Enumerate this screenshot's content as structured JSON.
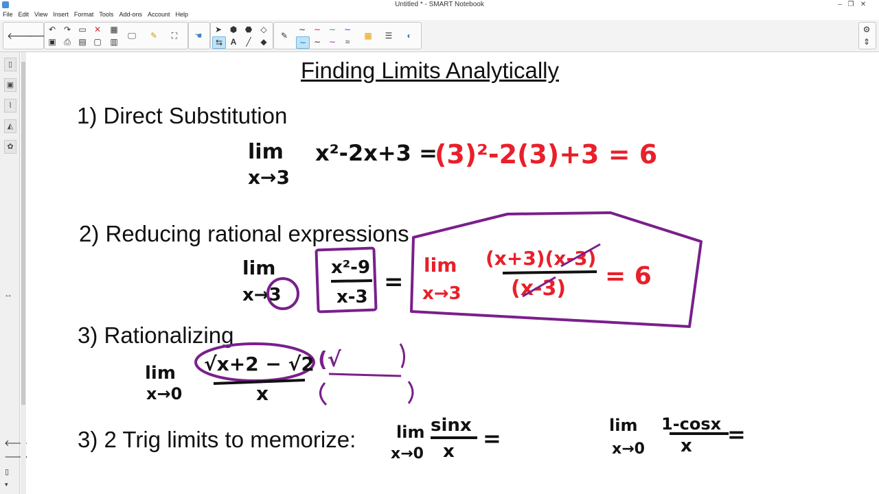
{
  "window": {
    "title": "Untitled * - SMART Notebook"
  },
  "menu": [
    "File",
    "Edit",
    "View",
    "Insert",
    "Format",
    "Tools",
    "Add-ons",
    "Account",
    "Help"
  ],
  "toolbar": {
    "icons": [
      "back-arrow-icon",
      "forward-arrow-icon",
      "undo-icon",
      "redo-icon",
      "paste-icon",
      "delete-icon",
      "table-icon",
      "screen-shade-icon",
      "capture-icon",
      "document-camera-icon",
      "select-icon",
      "shapes-icon",
      "fill-icon",
      "eraser-icon",
      "pen-icon",
      "line-icon",
      "text-icon",
      "magic-pen-icon",
      "grid-icon",
      "properties-icon",
      "settings-icon"
    ]
  },
  "page": {
    "title": "Finding Limits Analytically",
    "section1": "1) Direct Substitution",
    "section2": "2) Reducing rational expressions",
    "section3": "3) Rationalizing",
    "section4": "3) 2 Trig limits to memorize:"
  },
  "handwriting": {
    "s1_lim": "lim",
    "s1_sub": "x→3",
    "s1_expr": "x²-2x+3 =",
    "s1_result": "(3)²-2(3)+3 = 6",
    "s2_lim": "lim",
    "s2_sub": "x→3",
    "s2_num": "x²-9",
    "s2_den": "x-3",
    "s2_eq": "=",
    "s2_red_lim": "lim",
    "s2_red_sub": "x→3",
    "s2_red_num": "(x+3)(x-3)",
    "s2_red_den": "(x-3)",
    "s2_red_result": "= 6",
    "s3_lim": "lim",
    "s3_sub": "x→0",
    "s3_num": "√x+2 − √2",
    "s3_den": "x",
    "s3_paren": "(√",
    "s4_lim1": "lim",
    "s4_sub1": "x→0",
    "s4_num1": "sinx",
    "s4_den1": "x",
    "s4_eq1": "=",
    "s4_lim2": "lim",
    "s4_sub2": "x→0",
    "s4_num2": "1-cosx",
    "s4_den2": "x",
    "s4_eq2": "="
  },
  "colors": {
    "ink_black": "#111111",
    "ink_red": "#e8202a",
    "ink_purple": "#7a1f8c",
    "toolbar_bg": "#f3f3f3"
  }
}
